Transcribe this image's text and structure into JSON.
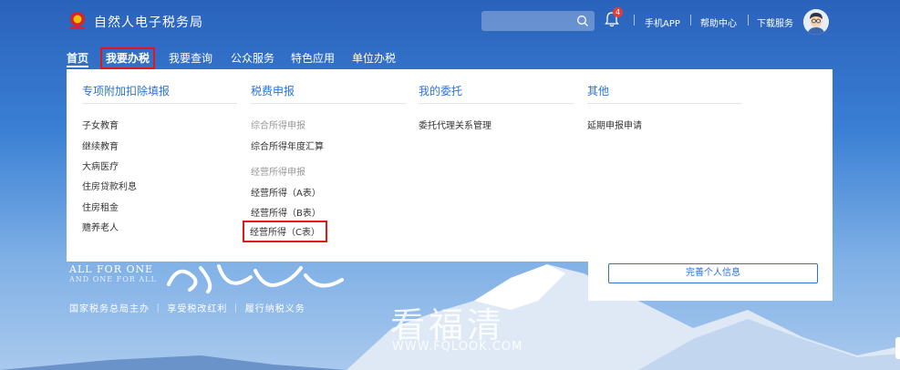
{
  "header": {
    "title": "自然人电子税务局",
    "search_placeholder": "",
    "notification_count": "4",
    "links": [
      "手机APP",
      "帮助中心",
      "下载服务"
    ]
  },
  "nav": {
    "items": [
      "首页",
      "我要办税",
      "我要查询",
      "公众服务",
      "特色应用",
      "单位办税"
    ]
  },
  "menu": {
    "col1": {
      "title": "专项附加扣除填报",
      "items": [
        "子女教育",
        "继续教育",
        "大病医疗",
        "住房贷款利息",
        "住房租金",
        "赡养老人"
      ]
    },
    "col2": {
      "title": "税费申报",
      "group1": "综合所得申报",
      "group1_items": [
        "综合所得年度汇算"
      ],
      "group2": "经营所得申报",
      "group2_items": [
        "经营所得（A表）",
        "经营所得（B表）",
        "经营所得（C表）"
      ]
    },
    "col3": {
      "title": "我的委托",
      "items": [
        "委托代理关系管理"
      ]
    },
    "col4": {
      "title": "其他",
      "items": [
        "延期申报申请"
      ]
    }
  },
  "banner": {
    "line1": "ALL FOR ONE",
    "line2": "AND ONE FOR ALL",
    "slogan": "国家税务总局主办 ｜ 享受税改红利 ｜ 履行纳税义务",
    "calligraphy": "我为人人"
  },
  "card": {
    "button": "完善个人信息"
  },
  "watermark": {
    "text": "看福清",
    "url": "WWW.FQLOOK.COM"
  },
  "colors": {
    "accent": "#2b72d6",
    "highlight_box": "#e01818",
    "badge": "#e93a3a"
  }
}
